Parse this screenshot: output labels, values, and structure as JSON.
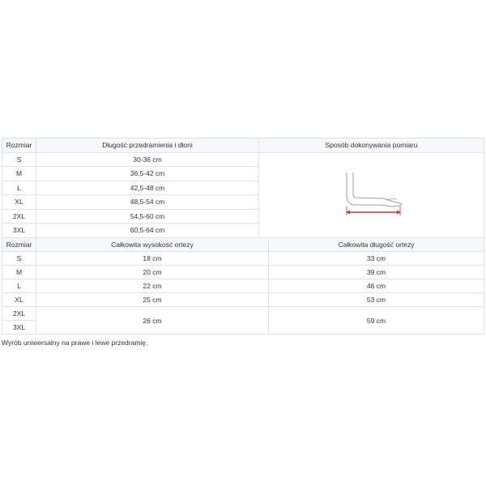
{
  "table1": {
    "headers": [
      "Rozmiar",
      "Długość przedramienia i dłoni",
      "Sposób dokonywania pomiaru"
    ],
    "rows": [
      {
        "size": "S",
        "value": "30-36 cm"
      },
      {
        "size": "M",
        "value": "36,5-42 cm"
      },
      {
        "size": "L",
        "value": "42,5-48 cm"
      },
      {
        "size": "XL",
        "value": "48,5-54 cm"
      },
      {
        "size": "2XL",
        "value": "54,5-60 cm"
      },
      {
        "size": "3XL",
        "value": "60,5-64 cm"
      }
    ],
    "diagram": {
      "icon": "forearm-measurement-icon",
      "arrow_color": "#c0392b"
    }
  },
  "table2": {
    "headers": [
      "Rozmiar",
      "Całkowita wysokość ortezy",
      "Całkowita długość ortezy"
    ],
    "rows": [
      {
        "size": "S",
        "height": "18 cm",
        "length": "33 cm"
      },
      {
        "size": "M",
        "height": "20 cm",
        "length": "39 cm"
      },
      {
        "size": "L",
        "height": "22 cm",
        "length": "46 cm"
      },
      {
        "size": "XL",
        "height": "25 cm",
        "length": "53 cm"
      },
      {
        "size": "2XL",
        "height": "",
        "length": ""
      },
      {
        "size": "3XL",
        "height": "26 cm",
        "length": "59 cm"
      }
    ]
  },
  "note": "Wyrób uniwersalny na prawe i lewe przedramię."
}
